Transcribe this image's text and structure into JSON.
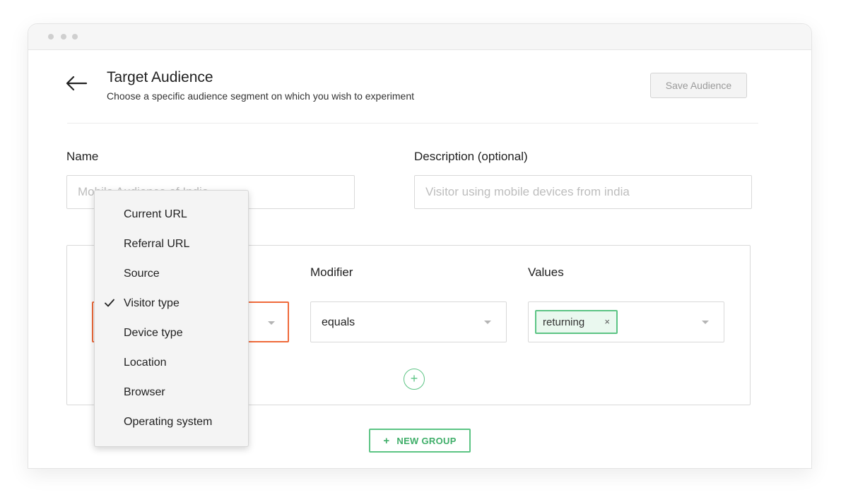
{
  "header": {
    "title": "Target Audience",
    "subtitle": "Choose a specific audience segment on which you wish to experiment",
    "save_label": "Save Audience"
  },
  "form": {
    "name_label": "Name",
    "name_placeholder": "Mobile Audience of India",
    "description_label": "Description (optional)",
    "description_placeholder": "Visitor using mobile devices from india"
  },
  "rule": {
    "modifier_label": "Modifier",
    "values_label": "Values",
    "modifier_value": "equals",
    "value_tag": "returning",
    "tag_remove_symbol": "×"
  },
  "dropdown": {
    "items": [
      {
        "label": "Current URL",
        "selected": false
      },
      {
        "label": "Referral URL",
        "selected": false
      },
      {
        "label": "Source",
        "selected": false
      },
      {
        "label": "Visitor type",
        "selected": true
      },
      {
        "label": "Device type",
        "selected": false
      },
      {
        "label": "Location",
        "selected": false
      },
      {
        "label": "Browser",
        "selected": false
      },
      {
        "label": "Operating system",
        "selected": false
      }
    ]
  },
  "actions": {
    "add_rule_symbol": "+",
    "new_group_plus": "+",
    "new_group_label": "NEW GROUP"
  },
  "colors": {
    "accent_green": "#5cc484",
    "active_orange": "#ef6a3a"
  }
}
